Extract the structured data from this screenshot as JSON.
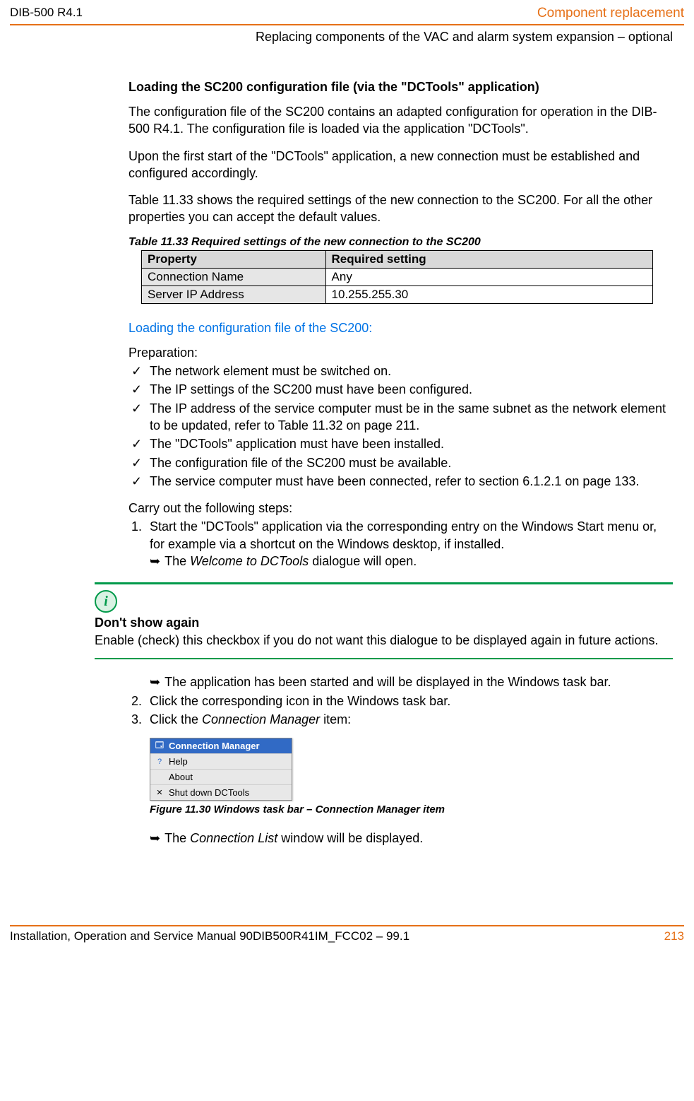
{
  "header": {
    "left": "DIB-500 R4.1",
    "right": "Component replacement",
    "sub": "Replacing components of the VAC and alarm system expansion – optional"
  },
  "section1": {
    "heading": "Loading the SC200 configuration file (via the \"DCTools\" application)",
    "p1": "The configuration file of the SC200 contains an adapted configuration for operation in the DIB-500 R4.1. The configuration file is loaded via the application \"DCTools\".",
    "p2": "Upon the first start of the \"DCTools\" application, a new connection must be established and configured accordingly.",
    "p3": "Table 11.33 shows the required settings of the new connection to the SC200. For all the other properties you can accept the default values."
  },
  "table": {
    "caption": "Table 11.33 Required settings of the new connection to the SC200",
    "h1": "Property",
    "h2": "Required setting",
    "r1c1": "Connection Name",
    "r1c2": "Any",
    "r2c1": "Server IP Address",
    "r2c2": "10.255.255.30"
  },
  "blueheading": "Loading the configuration file of the SC200:",
  "prep_label": "Preparation:",
  "checks": {
    "0": "The network element must be switched on.",
    "1": "The IP settings of the SC200 must have been configured.",
    "2": "The IP address of the service computer must be in the same subnet as the network element to be updated, refer to Table 11.32 on page 211.",
    "3": "The \"DCTools\" application must have been installed.",
    "4": "The configuration file of the SC200 must be available.",
    "5": "The service computer must have been connected, refer to section 6.1.2.1 on page 133."
  },
  "carry_label": "Carry out the following steps:",
  "steps": {
    "0": "Start the \"DCTools\" application via the corresponding entry on the Windows Start menu or, for example via a shortcut on the Windows desktop, if installed.",
    "0_arrow_pre": "The ",
    "0_arrow_ital": "Welcome to DCTools",
    "0_arrow_post": " dialogue will open.",
    "1_arrow": "The application has been started and will be displayed in the Windows task bar.",
    "1": "Click the corresponding icon in the Windows task bar.",
    "2_pre": "Click the ",
    "2_ital": "Connection Manager",
    "2_post": " item:"
  },
  "note": {
    "title": "Don't show again",
    "body": "Enable (check) this checkbox if you do not want this dialogue to be displayed again in future actions."
  },
  "menu": {
    "0": "Connection Manager",
    "1": "Help",
    "2": "About",
    "3": "Shut down DCTools"
  },
  "figure_caption": "Figure 11.30 Windows task bar – Connection Manager item",
  "final_arrow_pre": "The ",
  "final_arrow_ital": "Connection List",
  "final_arrow_post": " window will be displayed.",
  "footer": {
    "left": "Installation, Operation and Service Manual 90DIB500R41IM_FCC02  –  99.1",
    "right": "213"
  }
}
